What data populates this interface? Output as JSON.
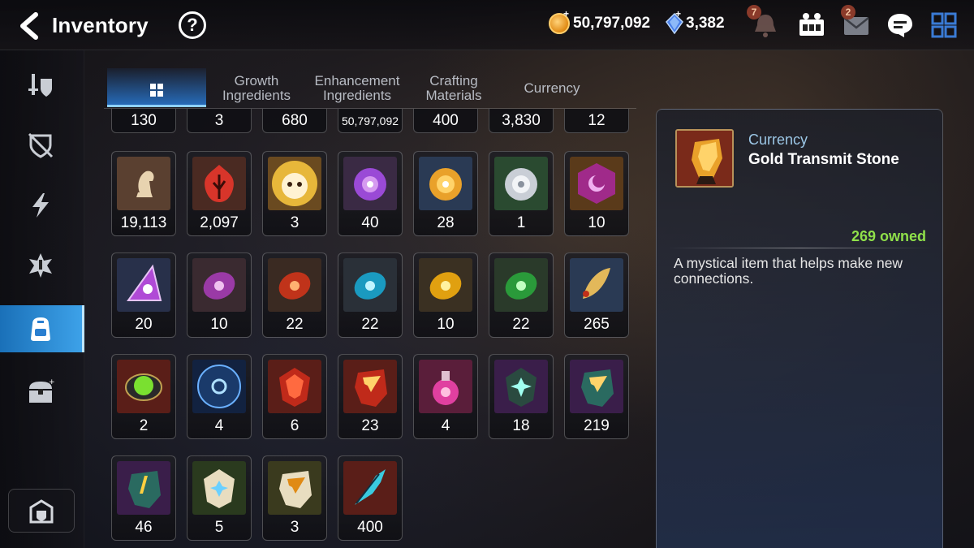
{
  "header": {
    "title": "Inventory",
    "help_label": "?",
    "gold": "50,797,092",
    "crystals": "3,382",
    "notifications_badge": "7",
    "mail_badge": "2",
    "plus_sign": "+"
  },
  "tabs": [
    {
      "label": "",
      "icon": "grid-icon",
      "active": true
    },
    {
      "label": "Growth\nIngredients"
    },
    {
      "label": "Enhancement\nIngredients"
    },
    {
      "label": "Crafting\nMaterials"
    },
    {
      "label": "Currency"
    }
  ],
  "sidebar": {
    "items": [
      {
        "icon": "equipment-icon"
      },
      {
        "icon": "artifact-icon"
      },
      {
        "icon": "lightning-icon"
      },
      {
        "icon": "catalyst-icon"
      },
      {
        "icon": "backpack-icon",
        "active": true
      },
      {
        "icon": "chest-icon"
      }
    ],
    "bottom_icon": "storage-icon"
  },
  "top_row_counts": [
    "130",
    "3",
    "680",
    "50,797,092",
    "400",
    "3,830",
    "12"
  ],
  "items": [
    {
      "count": "19,113",
      "icon": "chess-knight-icon"
    },
    {
      "count": "2,097",
      "icon": "flame-leaf-icon"
    },
    {
      "count": "3",
      "icon": "phantasma-icon"
    },
    {
      "count": "40",
      "icon": "purple-flower-icon"
    },
    {
      "count": "28",
      "icon": "gold-flower-icon"
    },
    {
      "count": "1",
      "icon": "silver-flower-icon"
    },
    {
      "count": "10",
      "icon": "purple-crest-icon"
    },
    {
      "count": "20",
      "icon": "purple-triangle-rune-icon"
    },
    {
      "count": "10",
      "icon": "purple-rune-icon"
    },
    {
      "count": "22",
      "icon": "red-rune-icon"
    },
    {
      "count": "22",
      "icon": "blue-rune-icon"
    },
    {
      "count": "10",
      "icon": "yellow-rune-icon"
    },
    {
      "count": "22",
      "icon": "green-rune-icon"
    },
    {
      "count": "265",
      "icon": "fish-icon"
    },
    {
      "count": "2",
      "icon": "green-orb-icon"
    },
    {
      "count": "4",
      "icon": "blue-sigil-icon"
    },
    {
      "count": "6",
      "icon": "red-stone-icon"
    },
    {
      "count": "23",
      "icon": "red-transmit-stone-icon"
    },
    {
      "count": "4",
      "icon": "potion-icon"
    },
    {
      "count": "18",
      "icon": "teal-stone-icon"
    },
    {
      "count": "219",
      "icon": "teal-transmit-stone-icon"
    },
    {
      "count": "46",
      "icon": "yellow-stone-icon"
    },
    {
      "count": "5",
      "icon": "white-stone-icon"
    },
    {
      "count": "3",
      "icon": "white-transmit-stone-icon"
    },
    {
      "count": "400",
      "icon": "crystal-feather-icon"
    }
  ],
  "detail": {
    "category": "Currency",
    "name": "Gold Transmit Stone",
    "owned": "269 owned",
    "description": "A mystical item that helps make new connections."
  },
  "colors": {
    "accent_blue": "#2f8fdc",
    "owned_green": "#8fe04a",
    "category_blue": "#9cc7e6"
  }
}
